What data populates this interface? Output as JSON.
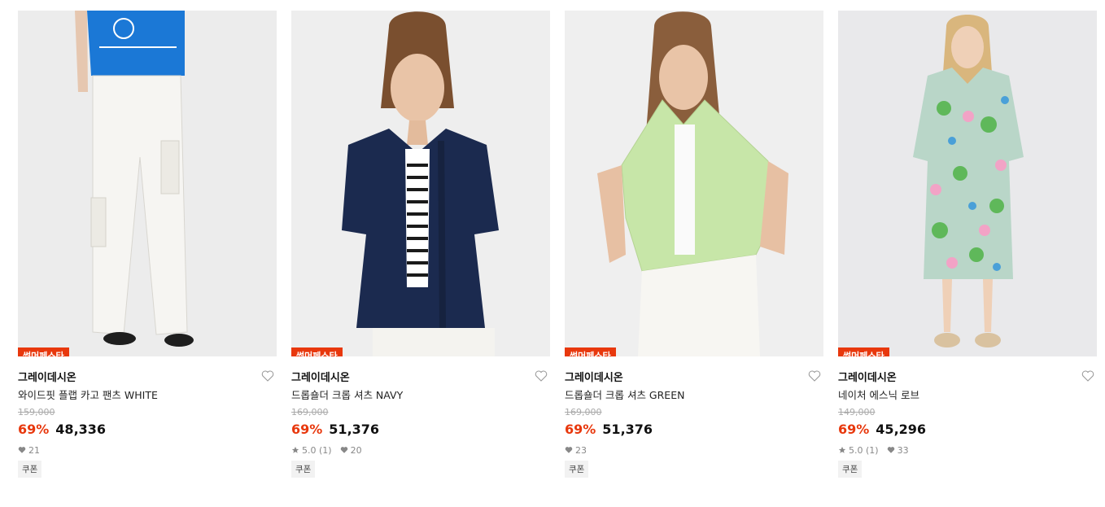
{
  "colors": {
    "badge": "#e8380d",
    "discount": "#e8380d"
  },
  "products": [
    {
      "badge": "썸머페스타",
      "brand": "그레이데시온",
      "name": "와이드핏 플랩 카고 팬츠 WHITE",
      "original_price": "159,000",
      "discount": "69%",
      "price": "48,336",
      "rating": null,
      "reviews": null,
      "likes": "21",
      "coupon": "쿠폰"
    },
    {
      "badge": "썸머페스타",
      "brand": "그레이데시온",
      "name": "드롭숄더 크롭 셔츠 NAVY",
      "original_price": "169,000",
      "discount": "69%",
      "price": "51,376",
      "rating": "5.0",
      "reviews": "(1)",
      "likes": "20",
      "coupon": "쿠폰"
    },
    {
      "badge": "썸머페스타",
      "brand": "그레이데시온",
      "name": "드롭숄더 크롭 셔츠 GREEN",
      "original_price": "169,000",
      "discount": "69%",
      "price": "51,376",
      "rating": null,
      "reviews": null,
      "likes": "23",
      "coupon": "쿠폰"
    },
    {
      "badge": "썸머페스타",
      "brand": "그레이데시온",
      "name": "네이처 에스닉 로브",
      "original_price": "149,000",
      "discount": "69%",
      "price": "45,296",
      "rating": "5.0",
      "reviews": "(1)",
      "likes": "33",
      "coupon": "쿠폰"
    }
  ]
}
